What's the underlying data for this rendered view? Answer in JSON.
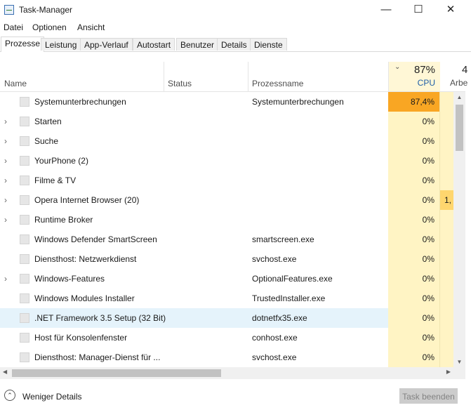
{
  "window": {
    "title": "Task-Manager",
    "min_glyph": "—",
    "max_glyph": "☐",
    "close_glyph": "✕"
  },
  "menu": [
    "Datei",
    "Optionen",
    "Ansicht"
  ],
  "tabs": [
    "Prozesse",
    "Leistung",
    "App-Verlauf",
    "Autostart",
    "Benutzer",
    "Details",
    "Dienste"
  ],
  "active_tab": "Prozesse",
  "columns": {
    "name": "Name",
    "status": "Status",
    "process_name": "Prozessname",
    "cpu_total": "87%",
    "cpu": "CPU",
    "arbeitsspeicher_partial": "Arbe",
    "arbeitsspeicher_top_partial": "4"
  },
  "rows": [
    {
      "name": "Systemunterbrechungen",
      "expandable": false,
      "process": "Systemunterbrechungen",
      "cpu": "87,4%",
      "cpu_hot": true,
      "arb": ""
    },
    {
      "name": "Starten",
      "expandable": true,
      "process": "",
      "cpu": "0%",
      "arb": ""
    },
    {
      "name": "Suche",
      "expandable": true,
      "process": "",
      "cpu": "0%",
      "arb": ""
    },
    {
      "name": "YourPhone (2)",
      "expandable": true,
      "process": "",
      "cpu": "0%",
      "arb": ""
    },
    {
      "name": "Filme & TV",
      "expandable": true,
      "process": "",
      "cpu": "0%",
      "arb": ""
    },
    {
      "name": "Opera Internet Browser (20)",
      "expandable": true,
      "process": "",
      "cpu": "0%",
      "arb": "1,",
      "arb_warm": true
    },
    {
      "name": "Runtime Broker",
      "expandable": true,
      "process": "",
      "cpu": "0%",
      "arb": ""
    },
    {
      "name": "Windows Defender SmartScreen",
      "expandable": false,
      "process": "smartscreen.exe",
      "cpu": "0%",
      "arb": ""
    },
    {
      "name": "Diensthost: Netzwerkdienst",
      "expandable": false,
      "process": "svchost.exe",
      "cpu": "0%",
      "arb": ""
    },
    {
      "name": "Windows-Features",
      "expandable": true,
      "process": "OptionalFeatures.exe",
      "cpu": "0%",
      "arb": ""
    },
    {
      "name": "Windows Modules Installer",
      "expandable": false,
      "process": "TrustedInstaller.exe",
      "cpu": "0%",
      "arb": ""
    },
    {
      "name": ".NET Framework 3.5 Setup (32 Bit)",
      "expandable": false,
      "process": "dotnetfx35.exe",
      "cpu": "0%",
      "arb": "",
      "highlighted": true
    },
    {
      "name": "Host für Konsolenfenster",
      "expandable": false,
      "process": "conhost.exe",
      "cpu": "0%",
      "arb": ""
    },
    {
      "name": "Diensthost: Manager-Dienst für ...",
      "expandable": false,
      "process": "svchost.exe",
      "cpu": "0%",
      "arb": ""
    }
  ],
  "footer": {
    "less_details": "Weniger Details",
    "end_task": "Task beenden"
  },
  "colors": {
    "cpu_hot": "#f9a623",
    "cpu_col": "#fff4c4",
    "accent": "#1f5fa8",
    "row_highlight": "#e5f3fb"
  }
}
